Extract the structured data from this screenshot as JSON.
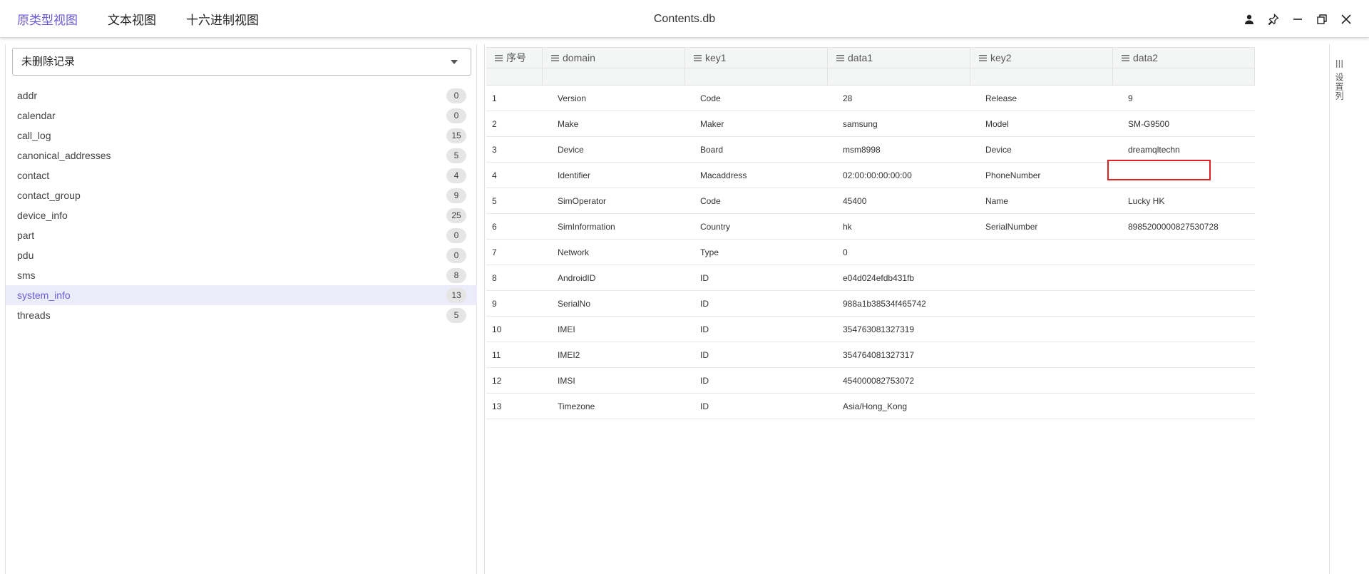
{
  "tabs": [
    {
      "label": "原类型视图",
      "active": true
    },
    {
      "label": "文本视图",
      "active": false
    },
    {
      "label": "十六进制视图",
      "active": false
    }
  ],
  "document_title": "Contents.db",
  "window_controls": [
    "user-icon",
    "pin-icon",
    "minimize-icon",
    "restore-icon",
    "close-icon"
  ],
  "filter_select": {
    "value": "未删除记录"
  },
  "tables": [
    {
      "name": "addr",
      "count": "0",
      "active": false
    },
    {
      "name": "calendar",
      "count": "0",
      "active": false
    },
    {
      "name": "call_log",
      "count": "15",
      "active": false
    },
    {
      "name": "canonical_addresses",
      "count": "5",
      "active": false
    },
    {
      "name": "contact",
      "count": "4",
      "active": false
    },
    {
      "name": "contact_group",
      "count": "9",
      "active": false
    },
    {
      "name": "device_info",
      "count": "25",
      "active": false
    },
    {
      "name": "part",
      "count": "0",
      "active": false
    },
    {
      "name": "pdu",
      "count": "0",
      "active": false
    },
    {
      "name": "sms",
      "count": "8",
      "active": false
    },
    {
      "name": "system_info",
      "count": "13",
      "active": true
    },
    {
      "name": "threads",
      "count": "5",
      "active": false
    }
  ],
  "grid": {
    "columns": [
      "序号",
      "domain",
      "key1",
      "data1",
      "key2",
      "data2"
    ],
    "rows": [
      [
        "1",
        "Version",
        "Code",
        "28",
        "Release",
        "9"
      ],
      [
        "2",
        "Make",
        "Maker",
        "samsung",
        "Model",
        "SM-G9500"
      ],
      [
        "3",
        "Device",
        "Board",
        "msm8998",
        "Device",
        "dreamqltechn"
      ],
      [
        "4",
        "Identifier",
        "Macaddress",
        "02:00:00:00:00:00",
        "PhoneNumber",
        ""
      ],
      [
        "5",
        "SimOperator",
        "Code",
        "45400",
        "Name",
        "Lucky HK"
      ],
      [
        "6",
        "SimInformation",
        "Country",
        "hk",
        "SerialNumber",
        "8985200000827530728"
      ],
      [
        "7",
        "Network",
        "Type",
        "0",
        "",
        ""
      ],
      [
        "8",
        "AndroidID",
        "ID",
        "e04d024efdb431fb",
        "",
        ""
      ],
      [
        "9",
        "SerialNo",
        "ID",
        "988a1b38534f465742",
        "",
        ""
      ],
      [
        "10",
        "IMEI",
        "ID",
        "354763081327319",
        "",
        ""
      ],
      [
        "11",
        "IMEI2",
        "ID",
        "354764081327317",
        "",
        ""
      ],
      [
        "12",
        "IMSI",
        "ID",
        "454000082753072",
        "",
        ""
      ],
      [
        "13",
        "Timezone",
        "ID",
        "Asia/Hong_Kong",
        "",
        ""
      ]
    ]
  },
  "side_panel": {
    "label": "设置列",
    "icon": "columns-icon"
  },
  "colors": {
    "accent": "#6b5bd6",
    "active_row_bg": "#ecebfa",
    "highlight": "#e02020"
  }
}
